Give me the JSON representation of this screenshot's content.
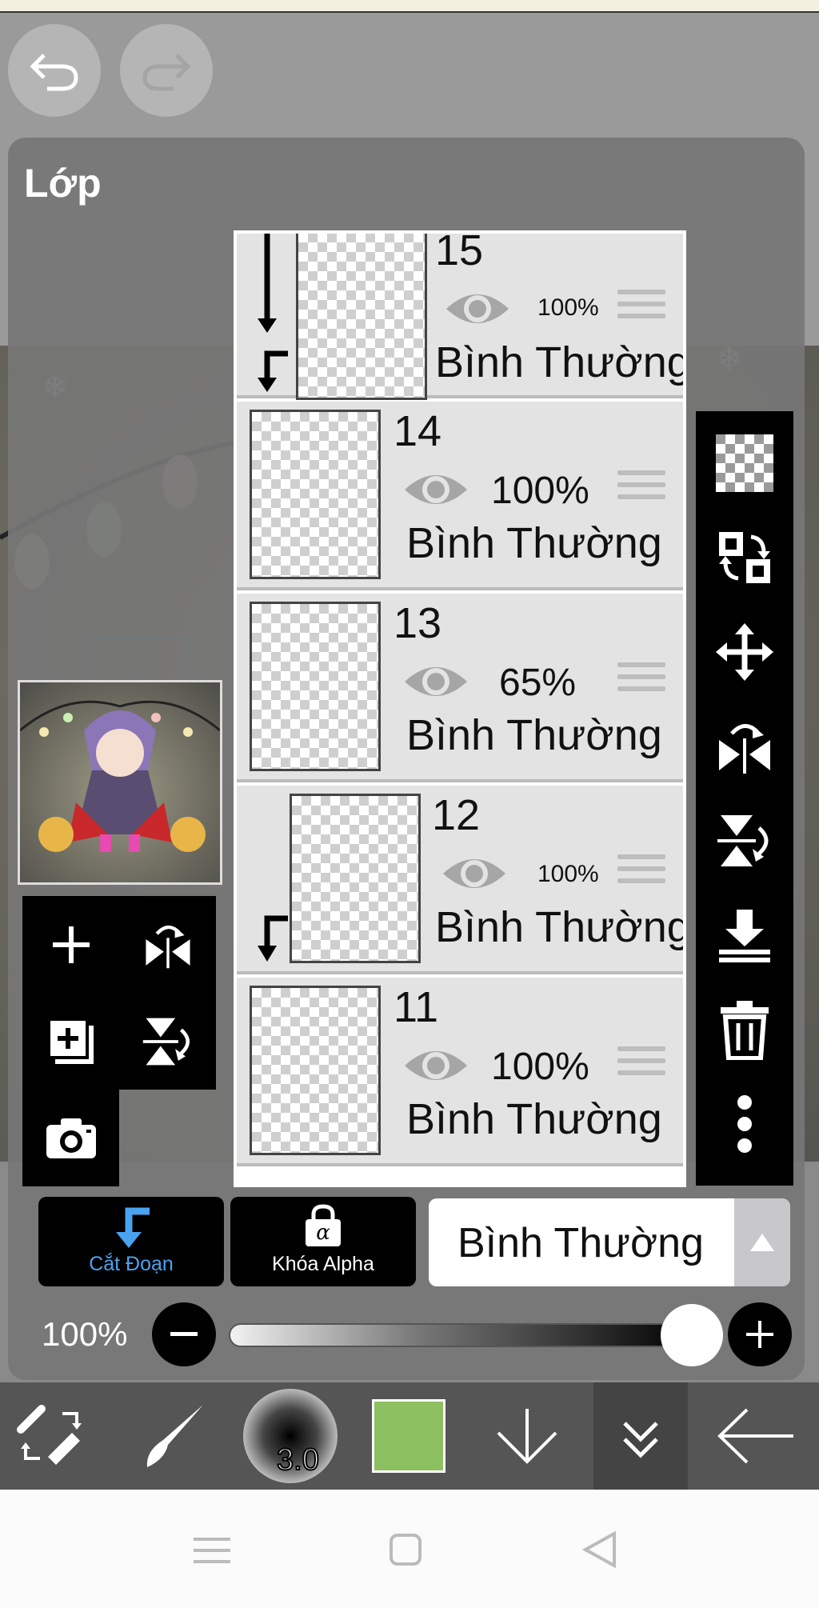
{
  "panel": {
    "title": "Lớp"
  },
  "layers": [
    {
      "number": "15",
      "opacity": "100%",
      "blend_mode": "Bình Thường",
      "clipped": true
    },
    {
      "number": "14",
      "opacity": "100%",
      "blend_mode": "Bình Thường",
      "clipped": false
    },
    {
      "number": "13",
      "opacity": "65%",
      "blend_mode": "Bình Thường",
      "clipped": false
    },
    {
      "number": "12",
      "opacity": "100%",
      "blend_mode": "Bình Thường",
      "clipped": true
    },
    {
      "number": "11",
      "opacity": "100%",
      "blend_mode": "Bình Thường",
      "clipped": false
    }
  ],
  "bottom_panel": {
    "clip_label": "Cắt Đoạn",
    "alpha_lock_label": "Khóa Alpha",
    "alpha_symbol": "α",
    "blend_mode": "Bình Thường",
    "opacity_label": "100%"
  },
  "brush": {
    "size": "3.0"
  },
  "colors": {
    "current_color": "#8dc060",
    "clip_accent": "#4aa3ef"
  },
  "icons": {
    "undo": "undo-icon",
    "redo": "redo-icon",
    "transparency": "checkerboard-icon",
    "swap": "swap-layers-icon",
    "move": "move-icon",
    "flip_h": "flip-horizontal-icon",
    "flip_v": "flip-vertical-icon",
    "merge_down": "merge-down-icon",
    "delete": "trash-icon",
    "more": "more-vertical-icon"
  }
}
